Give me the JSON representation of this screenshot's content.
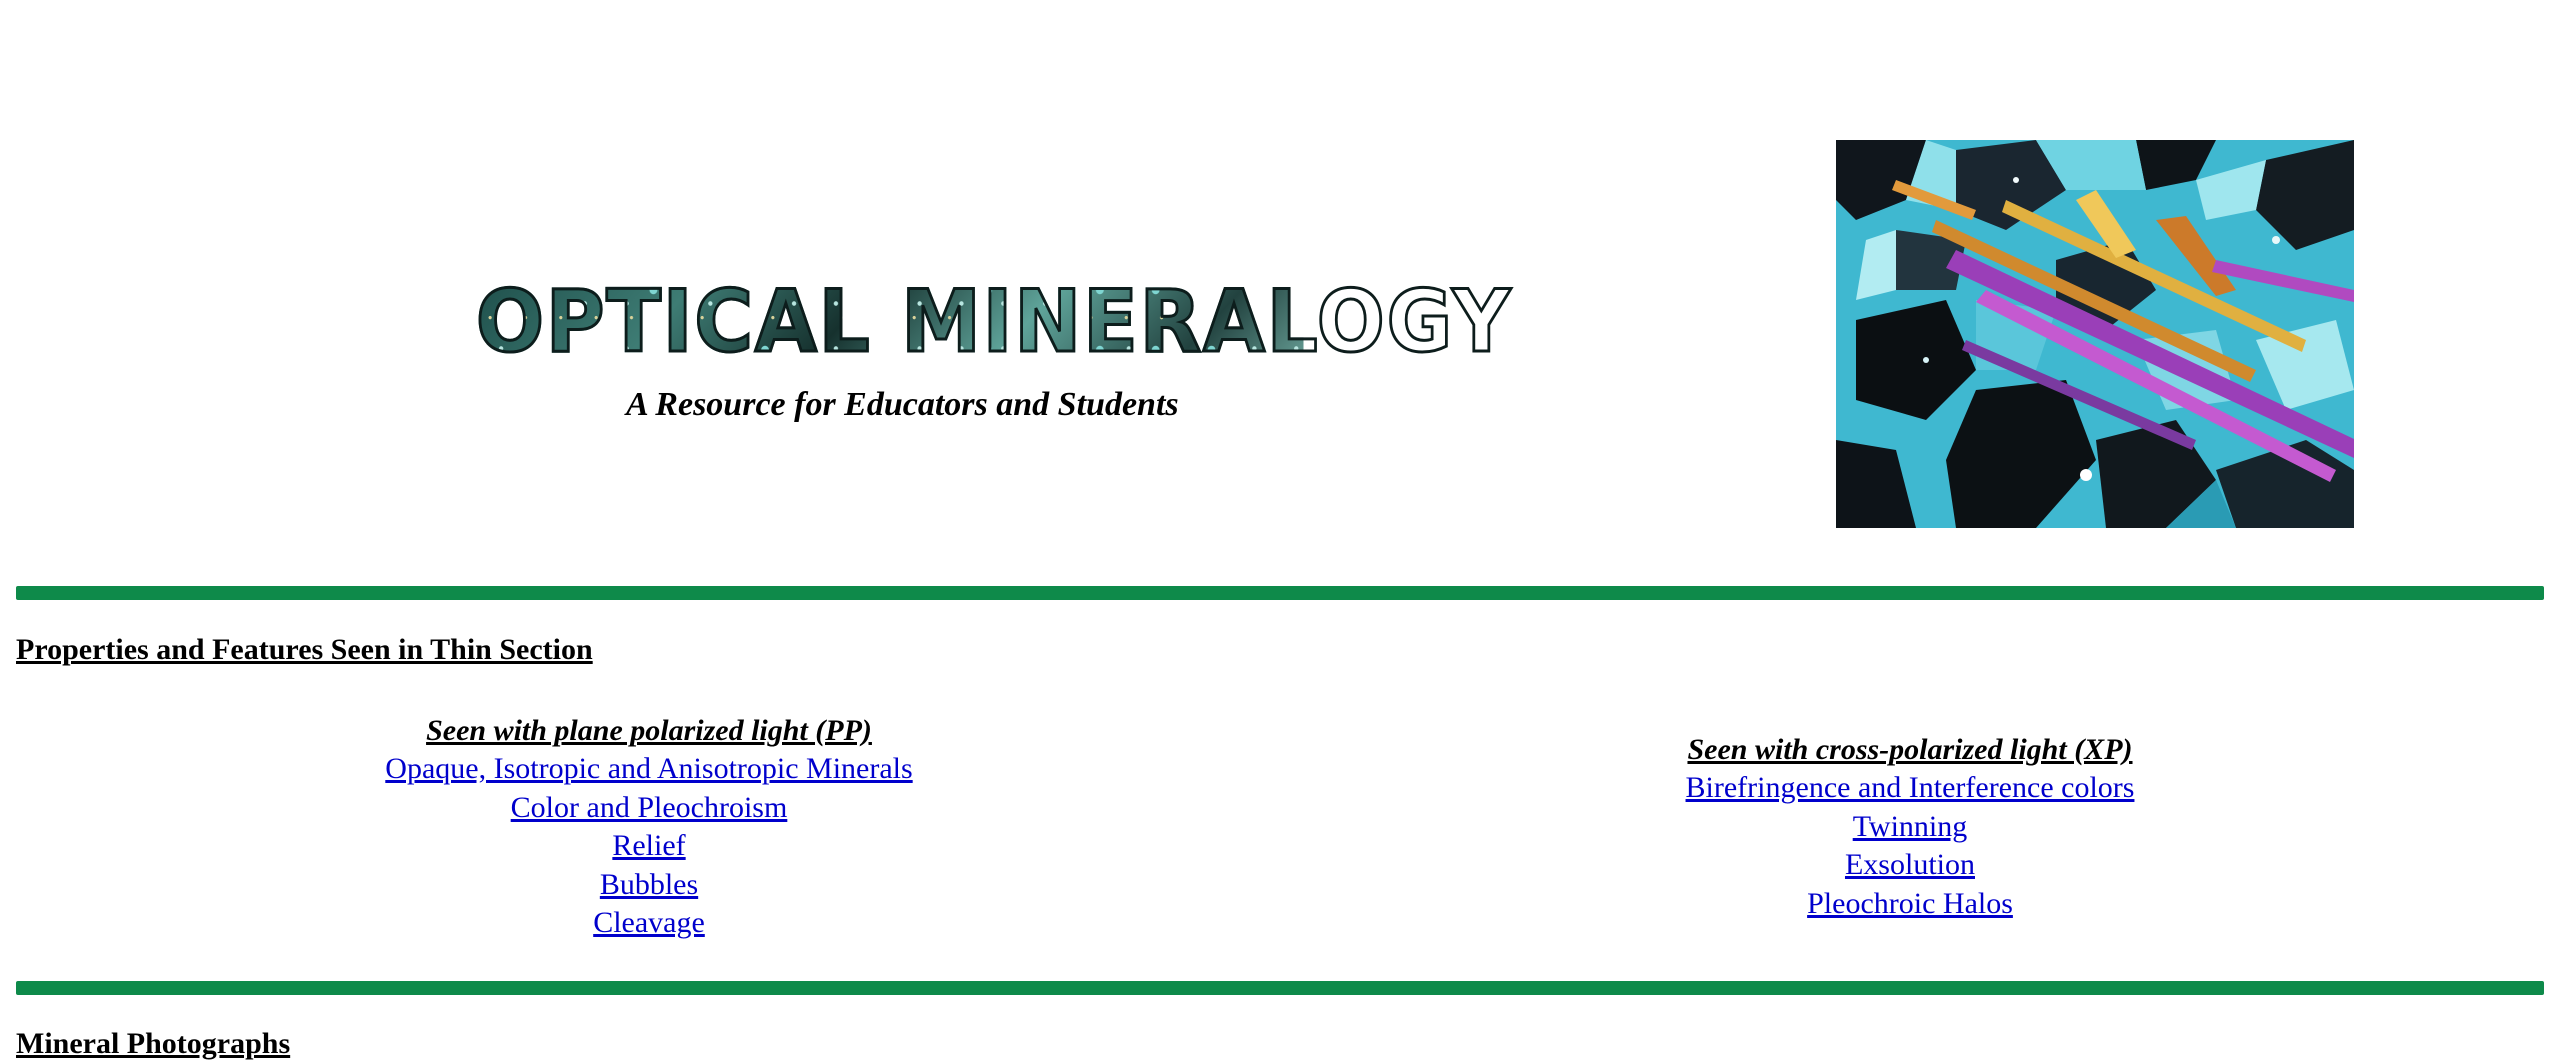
{
  "header": {
    "logo_text": "OPTICAL MINERALOGY",
    "subtitle": "A Resource for Educators and Students"
  },
  "colors": {
    "rule": "#0e8a4a",
    "link": "#0000cc",
    "text": "#000000",
    "background": "#ffffff"
  },
  "sections": {
    "thin_section": {
      "title": "Properties and Features Seen in Thin Section",
      "pp": {
        "heading": "Seen with plane polarized light (PP)",
        "links": [
          "Opaque, Isotropic and Anisotropic Minerals",
          "Color and Pleochroism",
          "Relief",
          "Bubbles",
          "Cleavage"
        ]
      },
      "xp": {
        "heading": " Seen with cross-polarized light (XP)",
        "links": [
          "Birefringence and Interference colors",
          "Twinning",
          "Exsolution",
          "Pleochroic Halos"
        ]
      }
    },
    "photos": {
      "title": "Mineral Photographs"
    }
  }
}
